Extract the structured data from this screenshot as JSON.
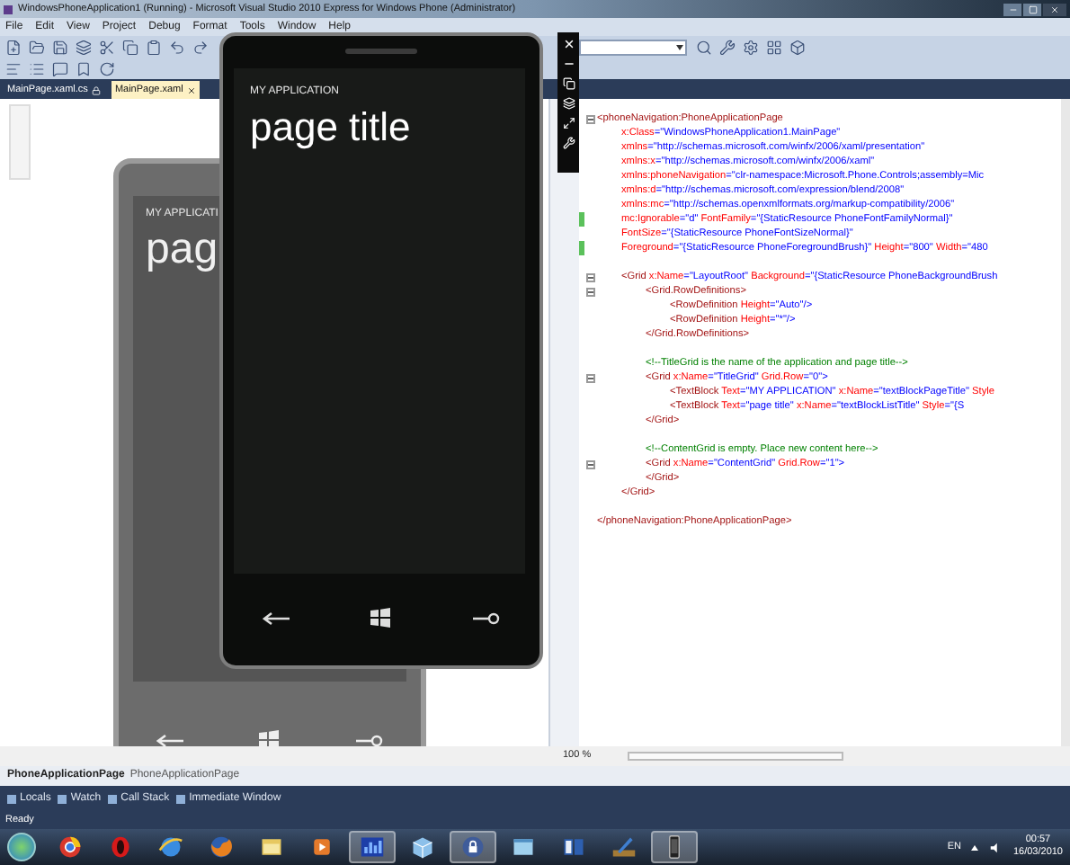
{
  "window": {
    "title": "WindowsPhoneApplication1 (Running) - Microsoft Visual Studio 2010 Express for Windows Phone (Administrator)"
  },
  "menu": [
    "File",
    "Edit",
    "View",
    "Project",
    "Debug",
    "Format",
    "Tools",
    "Window",
    "Help"
  ],
  "document_tabs": [
    {
      "label": "MainPage.xaml.cs",
      "selected": false
    },
    {
      "label": "MainPage.xaml",
      "selected": true
    }
  ],
  "designer": {
    "phone": {
      "app_title": "MY APPLICATI",
      "page_title": "pag"
    }
  },
  "emulator": {
    "app_title": "MY APPLICATION",
    "page_title": "page title"
  },
  "code": {
    "lines": [
      {
        "kind": "code",
        "fold": true,
        "changed": false,
        "tokens": [
          {
            "kind": "tag",
            "text": "<phoneNavigation:PhoneApplicationPage"
          }
        ],
        "children": [
          {
            "kind": "code",
            "fold": false,
            "changed": false,
            "tokens": [
              {
                "kind": "attr",
                "text": "x:Class"
              },
              {
                "kind": "value",
                "text": "=\"WindowsPhoneApplication1.MainPage\""
              }
            ]
          },
          {
            "kind": "code",
            "fold": false,
            "changed": false,
            "tokens": [
              {
                "kind": "attr",
                "text": "xmlns"
              },
              {
                "kind": "value",
                "text": "=\"http://schemas.microsoft.com/winfx/2006/xaml/presentation\""
              }
            ]
          },
          {
            "kind": "code",
            "fold": false,
            "changed": false,
            "tokens": [
              {
                "kind": "attr",
                "text": "xmlns:x"
              },
              {
                "kind": "value",
                "text": "=\"http://schemas.microsoft.com/winfx/2006/xaml\""
              }
            ]
          },
          {
            "kind": "code",
            "fold": false,
            "changed": false,
            "tokens": [
              {
                "kind": "attr",
                "text": "xmlns:phoneNavigation"
              },
              {
                "kind": "value",
                "text": "=\"clr-namespace:Microsoft.Phone.Controls;assembly=Mic"
              }
            ]
          },
          {
            "kind": "code",
            "fold": false,
            "changed": false,
            "tokens": [
              {
                "kind": "attr",
                "text": "xmlns:d"
              },
              {
                "kind": "value",
                "text": "=\"http://schemas.microsoft.com/expression/blend/2008\""
              }
            ]
          },
          {
            "kind": "code",
            "fold": false,
            "changed": false,
            "tokens": [
              {
                "kind": "attr",
                "text": "xmlns:mc"
              },
              {
                "kind": "value",
                "text": "=\"http://schemas.openxmlformats.org/markup-compatibility/2006\""
              }
            ]
          },
          {
            "kind": "code",
            "fold": false,
            "changed": true,
            "tokens": [
              {
                "kind": "attr",
                "text": "mc:Ignorable"
              },
              {
                "kind": "value",
                "text": "=\"d\""
              },
              {
                "kind": "attr",
                "text": " FontFamily"
              },
              {
                "kind": "value",
                "text": "=\"{StaticResource PhoneFontFamilyNormal}\""
              }
            ]
          },
          {
            "kind": "code",
            "fold": false,
            "changed": false,
            "tokens": [
              {
                "kind": "attr",
                "text": "FontSize"
              },
              {
                "kind": "value",
                "text": "=\"{StaticResource PhoneFontSizeNormal}\""
              }
            ]
          },
          {
            "kind": "code",
            "fold": false,
            "changed": true,
            "tokens": [
              {
                "kind": "attr",
                "text": "Foreground"
              },
              {
                "kind": "value",
                "text": "=\"{StaticResource PhoneForegroundBrush}\""
              },
              {
                "kind": "attr",
                "text": " Height"
              },
              {
                "kind": "value",
                "text": "=\"800\""
              },
              {
                "kind": "attr",
                "text": " Width"
              },
              {
                "kind": "value",
                "text": "=\"480"
              }
            ]
          },
          {
            "kind": "blank"
          },
          {
            "kind": "code",
            "fold": true,
            "changed": false,
            "tokens": [
              {
                "kind": "tag",
                "text": "<Grid"
              },
              {
                "kind": "attr",
                "text": " x:Name"
              },
              {
                "kind": "value",
                "text": "=\"LayoutRoot\""
              },
              {
                "kind": "attr",
                "text": " Background"
              },
              {
                "kind": "value",
                "text": "=\"{StaticResource PhoneBackgroundBrush"
              }
            ],
            "children": [
              {
                "kind": "code",
                "fold": true,
                "changed": false,
                "tokens": [
                  {
                    "kind": "tag",
                    "text": "<Grid.RowDefinitions>"
                  }
                ],
                "children": [
                  {
                    "kind": "code",
                    "fold": false,
                    "changed": false,
                    "tokens": [
                      {
                        "kind": "tag",
                        "text": "<RowDefinition"
                      },
                      {
                        "kind": "attr",
                        "text": " Height"
                      },
                      {
                        "kind": "value",
                        "text": "=\"Auto\"/>"
                      }
                    ]
                  },
                  {
                    "kind": "code",
                    "fold": false,
                    "changed": false,
                    "tokens": [
                      {
                        "kind": "tag",
                        "text": "<RowDefinition"
                      },
                      {
                        "kind": "attr",
                        "text": " Height"
                      },
                      {
                        "kind": "value",
                        "text": "=\"*\"/>"
                      }
                    ]
                  }
                ]
              },
              {
                "kind": "code",
                "fold": false,
                "changed": false,
                "tokens": [
                  {
                    "kind": "tag",
                    "text": "</Grid.RowDefinitions>"
                  }
                ]
              },
              {
                "kind": "blank"
              },
              {
                "kind": "code",
                "fold": false,
                "changed": false,
                "tokens": [
                  {
                    "kind": "comment",
                    "text": "<!--TitleGrid is the name of the application and page title-->"
                  }
                ]
              },
              {
                "kind": "code",
                "fold": true,
                "changed": false,
                "tokens": [
                  {
                    "kind": "tag",
                    "text": "<Grid"
                  },
                  {
                    "kind": "attr",
                    "text": " x:Name"
                  },
                  {
                    "kind": "value",
                    "text": "=\"TitleGrid\""
                  },
                  {
                    "kind": "attr",
                    "text": " Grid.Row"
                  },
                  {
                    "kind": "value",
                    "text": "=\"0\">"
                  }
                ],
                "children": [
                  {
                    "kind": "code",
                    "fold": false,
                    "changed": false,
                    "tokens": [
                      {
                        "kind": "tag",
                        "text": "<TextBlock"
                      },
                      {
                        "kind": "attr",
                        "text": " Text"
                      },
                      {
                        "kind": "value",
                        "text": "=\"MY APPLICATION\""
                      },
                      {
                        "kind": "attr",
                        "text": " x:Name"
                      },
                      {
                        "kind": "value",
                        "text": "=\"textBlockPageTitle\""
                      },
                      {
                        "kind": "attr",
                        "text": " Style"
                      }
                    ]
                  },
                  {
                    "kind": "code",
                    "fold": false,
                    "changed": false,
                    "tokens": [
                      {
                        "kind": "tag",
                        "text": "<TextBlock"
                      },
                      {
                        "kind": "attr",
                        "text": " Text"
                      },
                      {
                        "kind": "value",
                        "text": "=\"page title\""
                      },
                      {
                        "kind": "attr",
                        "text": " x:Name"
                      },
                      {
                        "kind": "value",
                        "text": "=\"textBlockListTitle\""
                      },
                      {
                        "kind": "attr",
                        "text": " Style"
                      },
                      {
                        "kind": "value",
                        "text": "=\"{S"
                      }
                    ]
                  }
                ]
              },
              {
                "kind": "code",
                "fold": false,
                "changed": false,
                "tokens": [
                  {
                    "kind": "tag",
                    "text": "</Grid>"
                  }
                ]
              },
              {
                "kind": "blank"
              },
              {
                "kind": "code",
                "fold": false,
                "changed": false,
                "tokens": [
                  {
                    "kind": "comment",
                    "text": "<!--ContentGrid is empty. Place new content here-->"
                  }
                ]
              },
              {
                "kind": "code",
                "fold": true,
                "changed": false,
                "tokens": [
                  {
                    "kind": "tag",
                    "text": "<Grid"
                  },
                  {
                    "kind": "attr",
                    "text": " x:Name"
                  },
                  {
                    "kind": "value",
                    "text": "=\"ContentGrid\""
                  },
                  {
                    "kind": "attr",
                    "text": " Grid.Row"
                  },
                  {
                    "kind": "value",
                    "text": "=\"1\">"
                  }
                ]
              },
              {
                "kind": "code",
                "fold": false,
                "changed": false,
                "tokens": [
                  {
                    "kind": "tag",
                    "text": "</Grid>"
                  }
                ]
              }
            ]
          },
          {
            "kind": "code",
            "fold": false,
            "changed": false,
            "tokens": [
              {
                "kind": "tag",
                "text": "</Grid>"
              }
            ]
          }
        ]
      },
      {
        "kind": "blank"
      },
      {
        "kind": "code",
        "fold": false,
        "changed": false,
        "tokens": [
          {
            "kind": "tag",
            "text": "</phoneNavigation:PhoneApplicationPage>"
          }
        ]
      }
    ]
  },
  "zoom_bar": {
    "zoom": "100 %"
  },
  "breadcrumb": [
    {
      "text": "PhoneApplicationPage",
      "bold": true
    },
    {
      "text": "PhoneApplicationPage",
      "bold": false
    }
  ],
  "tool_tabs": [
    "Locals",
    "Watch",
    "Call Stack",
    "Immediate Window"
  ],
  "status_bar": {
    "text": "Ready"
  },
  "taskbar": {
    "language": "EN",
    "time": "00:57",
    "date": "16/03/2010"
  }
}
